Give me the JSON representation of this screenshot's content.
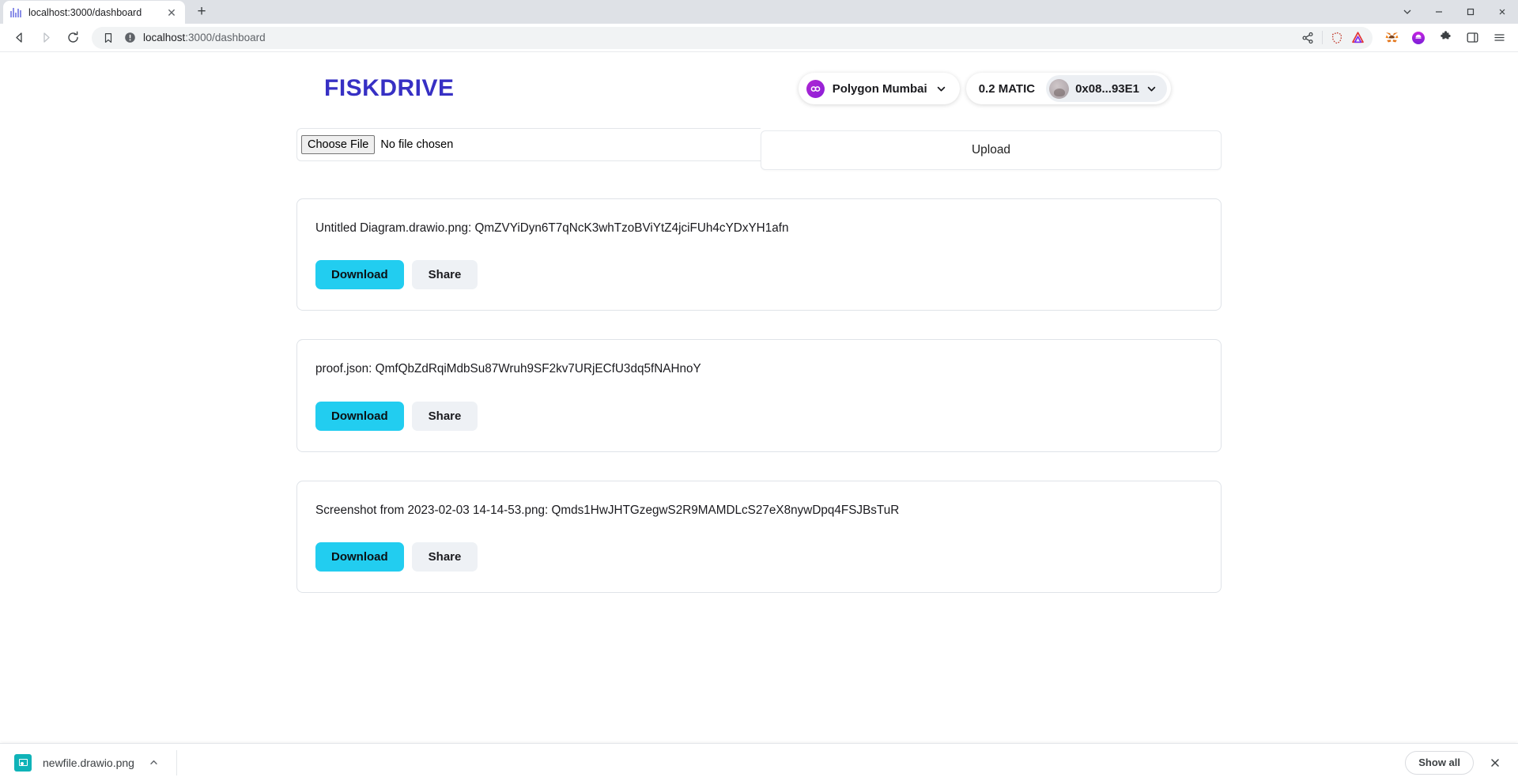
{
  "browser": {
    "tab": {
      "title": "localhost:3000/dashboard",
      "favicon_icon": "bars-favicon",
      "close_icon": "close-icon"
    },
    "new_tab_icon": "plus-icon",
    "window_controls": {
      "minimize_icon": "minimize-icon",
      "maximize_icon": "maximize-icon",
      "close_icon": "window-close-icon",
      "tab_search_icon": "chevron-down-icon"
    },
    "nav": {
      "back_icon": "back-arrow-icon",
      "forward_icon": "forward-arrow-icon",
      "reload_icon": "reload-icon",
      "bookmark_icon": "bookmark-icon"
    },
    "omnibox": {
      "security_icon": "not-secure-info-icon",
      "url_host": "localhost",
      "url_path": ":3000/dashboard",
      "url_full": "localhost:3000/dashboard",
      "share_icon": "share-icon",
      "shield_icon": "tracking-protection-shield-icon",
      "extension_badge_icon": "triangle-extension-icon"
    },
    "toolbar_right": {
      "metamask_icon": "metamask-fox-icon",
      "purple_ext_icon": "purple-extension-icon",
      "extensions_icon": "puzzle-piece-icon",
      "sidebar_icon": "sidebar-panel-icon",
      "menu_icon": "hamburger-menu-icon"
    }
  },
  "app": {
    "logo_text": "FISKDRIVE",
    "logo_color": "#3730c4",
    "network": {
      "icon": "polygon-network-icon",
      "label": "Polygon Mumbai",
      "chevron_icon": "chevron-down-icon"
    },
    "wallet": {
      "balance": "0.2 MATIC",
      "avatar_icon": "account-avatar-icon",
      "address": "0x08...93E1",
      "chevron_icon": "chevron-down-icon"
    },
    "upload": {
      "choose_file_label": "Choose File",
      "no_file_text": "No file chosen",
      "upload_label": "Upload"
    },
    "files": [
      {
        "title": "Untitled Diagram.drawio.png: QmZVYiDyn6T7qNcK3whTzoBViYtZ4jciFUh4cYDxYH1afn",
        "download_label": "Download",
        "share_label": "Share"
      },
      {
        "title": "proof.json: QmfQbZdRqiMdbSu87Wruh9SF2kv7URjECfU3dq5fNAHnoY",
        "download_label": "Download",
        "share_label": "Share"
      },
      {
        "title": "Screenshot from 2023-02-03 14-14-53.png: Qmds1HwJHTGzegwS2R9MAMDLcS27eX8nywDpq4FSJBsTuR",
        "download_label": "Download",
        "share_label": "Share"
      }
    ]
  },
  "download_shelf": {
    "file_icon": "image-file-icon",
    "file_name": "newfile.drawio.png",
    "expand_icon": "chevron-up-icon",
    "show_all_label": "Show all",
    "close_icon": "close-icon"
  },
  "colors": {
    "accent_cyan": "#22cdf0",
    "brand_indigo": "#3730c4",
    "polygon_purple": "#8b1fd8"
  }
}
